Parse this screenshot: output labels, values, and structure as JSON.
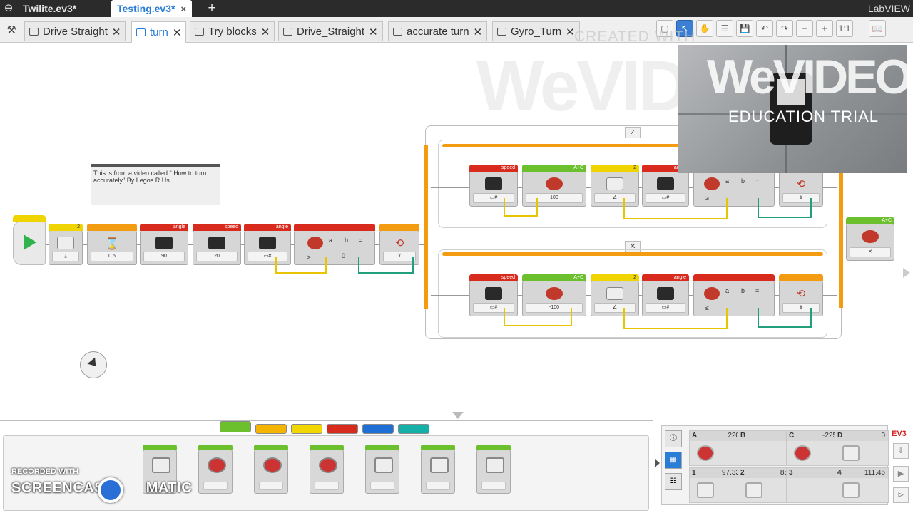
{
  "project_tabs": [
    {
      "label": "Twilite.ev3*",
      "active": false
    },
    {
      "label": "Testing.ev3*",
      "active": true
    }
  ],
  "project_close": "×",
  "add_project": "+",
  "app_name": "LabVIEW",
  "program_tabs": [
    {
      "label": "Drive Straight",
      "active": false
    },
    {
      "label": "turn",
      "active": true
    },
    {
      "label": "Try blocks",
      "active": false
    },
    {
      "label": "Drive_Straight",
      "active": false
    },
    {
      "label": "accurate turn",
      "active": false
    },
    {
      "label": "Gyro_Turn",
      "active": false
    }
  ],
  "tab_close": "✕",
  "toolbar_zoom": "1:1",
  "watermarks": {
    "wevideo": "WeVIDEO",
    "created_with": "CREATED WITH",
    "education_trial": "EDUCATION TRIAL",
    "recorded_with": "RECORDED WITH",
    "screencast": "SCREENCAST",
    "matic": "MATIC"
  },
  "comment": "This is from a video called \" How to turn accurately\" By Legos R Us",
  "main_sequence": {
    "block1_value": "2",
    "wait_value": "0.5",
    "var1_name": "angle",
    "var1_value": "90",
    "var2_name": "speed",
    "var2_value": "20",
    "var3_name": "angle",
    "compare_a": "a",
    "compare_b": "b",
    "compare_eq": "=",
    "compare_value": "0",
    "compare_op": "≥"
  },
  "switch": {
    "true_tick": "✓",
    "false_tick": "✕",
    "top": {
      "speed_label": "speed",
      "ports": "A+C",
      "value": "100",
      "sensor_port": "2",
      "angle_label": "angle",
      "op": "≥"
    },
    "bottom": {
      "speed_label": "speed",
      "ports": "A+C",
      "value": "-100",
      "sensor_port": "2",
      "angle_label": "angle",
      "op": "≤"
    }
  },
  "end_block": {
    "ports": "A+C"
  },
  "palette": {
    "tabs": [
      {
        "color": "#6cbf2d",
        "active": true
      },
      {
        "color": "#f5b400",
        "active": false
      },
      {
        "color": "#f2d600",
        "active": false
      },
      {
        "color": "#d82b1e",
        "active": false
      },
      {
        "color": "#1e6fd6",
        "active": false
      },
      {
        "color": "#15b0a8",
        "active": false
      }
    ],
    "blocks": [
      "brick-status-light",
      "medium-motor",
      "move-steering",
      "move-tank",
      "display",
      "sound",
      "brick-status"
    ]
  },
  "hardware": {
    "brand": "EV3",
    "ports": [
      {
        "name": "A",
        "value": "220",
        "kind": "motor"
      },
      {
        "name": "B",
        "value": "",
        "kind": "none"
      },
      {
        "name": "C",
        "value": "-225",
        "kind": "motor"
      },
      {
        "name": "D",
        "value": "0",
        "kind": "gray"
      },
      {
        "name": "1",
        "value": "97.33",
        "kind": "gray"
      },
      {
        "name": "2",
        "value": "85",
        "kind": "gray"
      },
      {
        "name": "3",
        "value": "",
        "kind": "none"
      },
      {
        "name": "4",
        "value": "111.46",
        "kind": "gray"
      }
    ]
  }
}
